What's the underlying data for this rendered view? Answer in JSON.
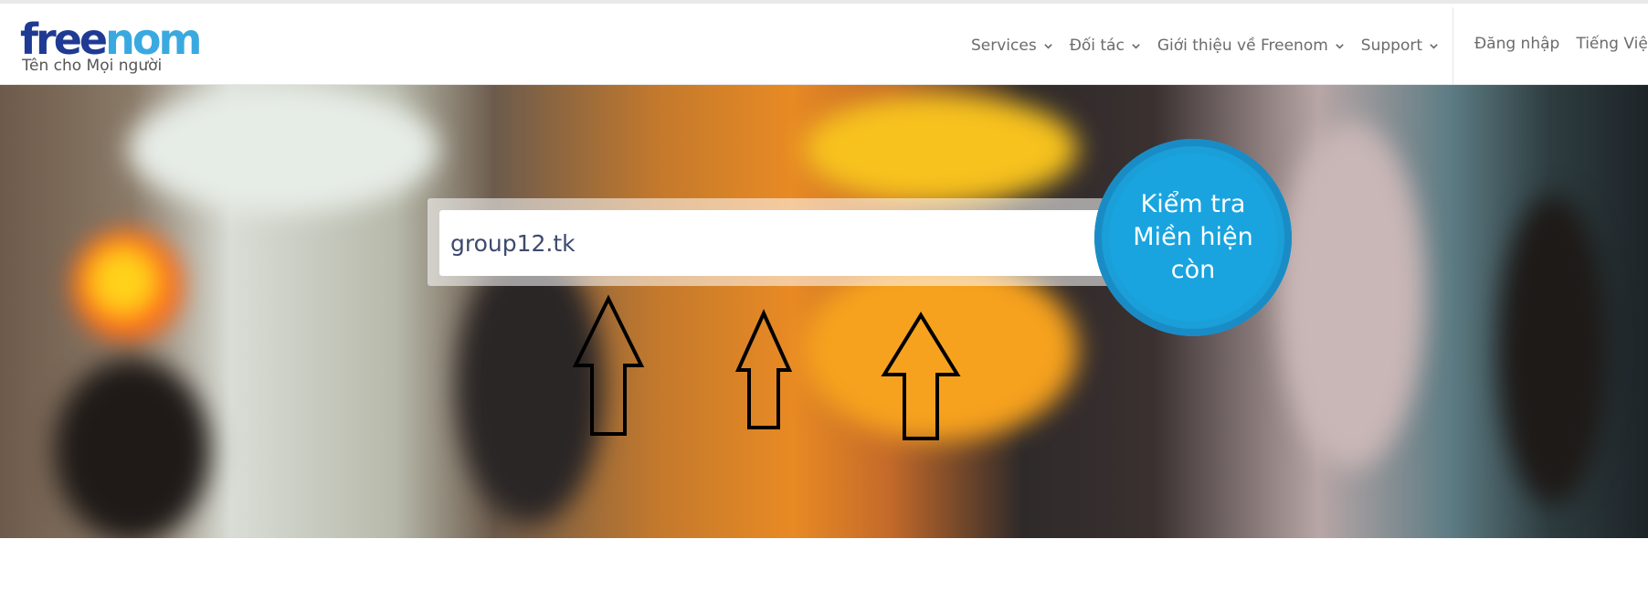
{
  "brand": {
    "logo_part1": "free",
    "logo_part2": "nom",
    "tagline": "Tên cho Mọi người",
    "logo_color_primary": "#1f3a93",
    "logo_color_accent": "#3aa9e0"
  },
  "nav": {
    "items": [
      {
        "label": "Services",
        "icon": "chevron-down-icon"
      },
      {
        "label": "Đối tác",
        "icon": "chevron-down-icon"
      },
      {
        "label": "Giới thiệu về Freenom",
        "icon": "chevron-down-icon"
      },
      {
        "label": "Support",
        "icon": "chevron-down-icon"
      }
    ],
    "login": "Đăng nhập",
    "language": "Tiếng Việt"
  },
  "search": {
    "value": "group12.tk",
    "button_label": "Kiểm tra Miền hiện còn",
    "button_color": "#1a9fd8"
  },
  "annotations": {
    "arrows": [
      "up-arrow-icon",
      "up-arrow-icon",
      "up-arrow-icon"
    ]
  }
}
